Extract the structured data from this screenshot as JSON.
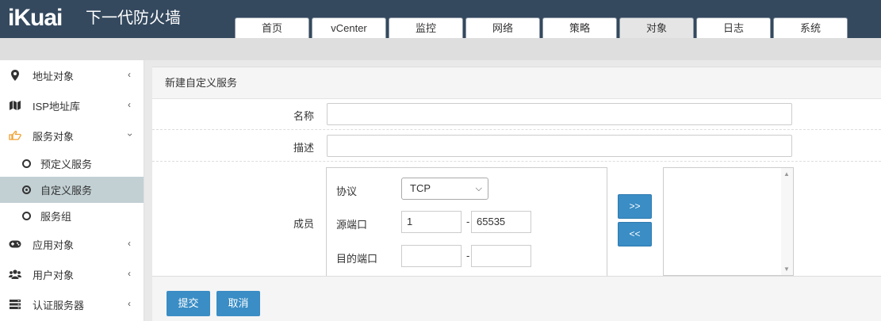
{
  "brand": {
    "logo": "iKuai",
    "product": "下一代防火墙"
  },
  "nav": {
    "tabs": [
      {
        "label": "首页",
        "active": false
      },
      {
        "label": "vCenter",
        "active": false
      },
      {
        "label": "监控",
        "active": false
      },
      {
        "label": "网络",
        "active": false
      },
      {
        "label": "策略",
        "active": false
      },
      {
        "label": "对象",
        "active": true
      },
      {
        "label": "日志",
        "active": false
      },
      {
        "label": "系统",
        "active": false
      }
    ]
  },
  "sidebar": {
    "items": [
      {
        "label": "地址对象",
        "icon": "map-marker-icon",
        "expanded": false
      },
      {
        "label": "ISP地址库",
        "icon": "map-icon",
        "expanded": false
      },
      {
        "label": "服务对象",
        "icon": "hand-pointer-icon",
        "expanded": true,
        "children": [
          {
            "label": "预定义服务",
            "active": false
          },
          {
            "label": "自定义服务",
            "active": true
          },
          {
            "label": "服务组",
            "active": false
          }
        ]
      },
      {
        "label": "应用对象",
        "icon": "gamepad-icon",
        "expanded": false
      },
      {
        "label": "用户对象",
        "icon": "users-icon",
        "expanded": false
      },
      {
        "label": "认证服务器",
        "icon": "server-icon",
        "expanded": false
      }
    ]
  },
  "form": {
    "title": "新建自定义服务",
    "name_label": "名称",
    "name_value": "",
    "desc_label": "描述",
    "desc_value": "",
    "member_label": "成员",
    "protocol_label": "协议",
    "protocol_value": "TCP",
    "src_port_label": "源端口",
    "src_port_from": "1",
    "src_port_to": "65535",
    "dst_port_label": "目的端口",
    "dst_port_from": "",
    "dst_port_to": "",
    "range_sep": "-",
    "add_label": ">>",
    "remove_label": "<<",
    "submit_label": "提交",
    "cancel_label": "取消"
  },
  "colors": {
    "header_bg": "#34495e",
    "accent": "#3a8dc5",
    "active_item": "#c2d0d4",
    "icon_orange": "#f0a030"
  }
}
